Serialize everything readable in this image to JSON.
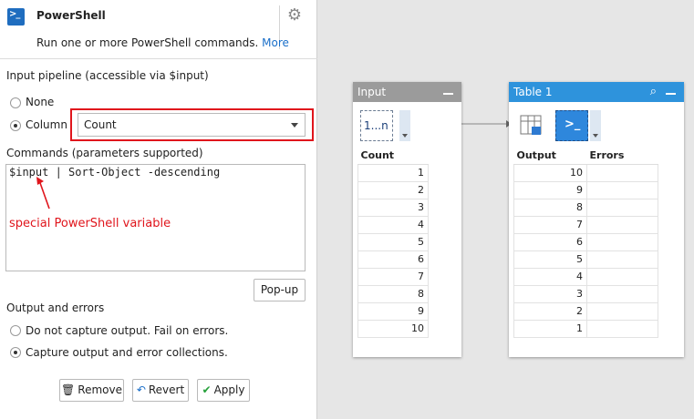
{
  "panel": {
    "title": "PowerShell",
    "description": "Run one or more PowerShell commands.",
    "more_link": "More",
    "input_pipeline_label": "Input pipeline (accessible via $input)",
    "option_none": "None",
    "option_column": "Column",
    "column_value": "Count",
    "commands_label": "Commands (parameters supported)",
    "command_text": "$input | Sort-Object -descending",
    "annotation": "special PowerShell variable",
    "popup_button": "Pop-up",
    "output_errors_label": "Output and errors",
    "option_no_capture": "Do not capture output. Fail on errors.",
    "option_capture": "Capture output and error collections.",
    "remove_button": "Remove",
    "revert_button": "Revert",
    "apply_button": "Apply"
  },
  "input_node": {
    "title": "Input",
    "tool_label": "1...n",
    "column_header": "Count",
    "rows": [
      "1",
      "2",
      "3",
      "4",
      "5",
      "6",
      "7",
      "8",
      "9",
      "10"
    ]
  },
  "table_node": {
    "title": "Table 1",
    "column_output": "Output",
    "column_errors": "Errors",
    "rows": [
      "10",
      "9",
      "8",
      "7",
      "6",
      "5",
      "4",
      "3",
      "2",
      "1"
    ]
  },
  "colors": {
    "accent_red": "#e0151c",
    "input_head": "#9b9b9b",
    "table_head": "#2e93dc",
    "link": "#1a6fc9"
  }
}
